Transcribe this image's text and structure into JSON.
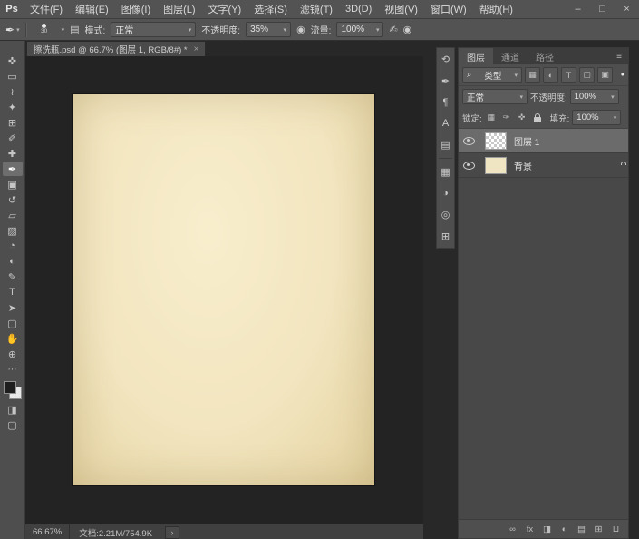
{
  "icons": {
    "caret": "▾",
    "search": "⌕",
    "dot": "●",
    "ellipsis": "⋯",
    "menu": "≡",
    "chevron": "›",
    "minimize": "–",
    "maximize": "□",
    "close": "×"
  },
  "menubar": {
    "logo": "Ps",
    "items": [
      {
        "label": "文件(F)"
      },
      {
        "label": "编辑(E)"
      },
      {
        "label": "图像(I)"
      },
      {
        "label": "图层(L)"
      },
      {
        "label": "文字(Y)"
      },
      {
        "label": "选择(S)"
      },
      {
        "label": "滤镜(T)"
      },
      {
        "label": "3D(D)"
      },
      {
        "label": "视图(V)"
      },
      {
        "label": "窗口(W)"
      },
      {
        "label": "帮助(H)"
      }
    ]
  },
  "optionsbar": {
    "tool_icon": "✒",
    "brush_size": "30",
    "brush_panel_icon": "▤",
    "mode_label": "模式:",
    "mode_value": "正常",
    "opacity_label": "不透明度:",
    "opacity_value": "35%",
    "pressure_opacity_icon": "◉",
    "flow_label": "流量:",
    "flow_value": "100%",
    "airbrush_icon": "✍",
    "pressure_size_icon": "◉"
  },
  "doc_tab": {
    "title": "擦洗瓶.psd @ 66.7% (图层 1, RGB/8#) *"
  },
  "tools": [
    {
      "name": "move-tool",
      "glyph": "✜"
    },
    {
      "name": "rectangular-marquee-tool",
      "glyph": "▭"
    },
    {
      "name": "lasso-tool",
      "glyph": "≀"
    },
    {
      "name": "quick-selection-tool",
      "glyph": "✦"
    },
    {
      "name": "crop-tool",
      "glyph": "⊞"
    },
    {
      "name": "eyedropper-tool",
      "glyph": "✐"
    },
    {
      "name": "spot-healing-brush-tool",
      "glyph": "✚"
    },
    {
      "name": "brush-tool",
      "glyph": "✒"
    },
    {
      "name": "clone-stamp-tool",
      "glyph": "▣"
    },
    {
      "name": "history-brush-tool",
      "glyph": "↺"
    },
    {
      "name": "eraser-tool",
      "glyph": "▱"
    },
    {
      "name": "gradient-tool",
      "glyph": "▨"
    },
    {
      "name": "blur-tool",
      "glyph": "◔"
    },
    {
      "name": "dodge-tool",
      "glyph": "◐"
    },
    {
      "name": "pen-tool",
      "glyph": "✎"
    },
    {
      "name": "type-tool",
      "glyph": "T"
    },
    {
      "name": "path-selection-tool",
      "glyph": "➤"
    },
    {
      "name": "rectangle-tool",
      "glyph": "▢"
    },
    {
      "name": "hand-tool",
      "glyph": "✋"
    },
    {
      "name": "zoom-tool",
      "glyph": "⊕"
    }
  ],
  "toolbar_extra": {
    "quick_mask_icon": "◨",
    "screen_mode_icon": "▢"
  },
  "panel_strip": [
    {
      "name": "history-panel",
      "glyph": "⟲"
    },
    {
      "name": "brush-presets-panel",
      "glyph": "✒"
    },
    {
      "name": "paragraph-panel",
      "glyph": "¶"
    },
    {
      "name": "character-panel",
      "glyph": "A"
    },
    {
      "name": "styles-panel",
      "glyph": "▤"
    },
    {
      "name": "swatches-panel",
      "glyph": "▦"
    },
    {
      "name": "adjustments-panel",
      "glyph": "◑"
    },
    {
      "name": "info-panel",
      "glyph": "◎"
    },
    {
      "name": "navigator-panel",
      "glyph": "⊞"
    }
  ],
  "layers_panel": {
    "tabs": [
      {
        "label": "图层"
      },
      {
        "label": "通道"
      },
      {
        "label": "路径"
      }
    ],
    "filter": {
      "kind": "类型",
      "icons": [
        {
          "name": "filter-pixel-layers",
          "glyph": "▦"
        },
        {
          "name": "filter-adjustment-layers",
          "glyph": "◐"
        },
        {
          "name": "filter-type-layers",
          "glyph": "T"
        },
        {
          "name": "filter-shape-layers",
          "glyph": "▢"
        },
        {
          "name": "filter-smart-objects",
          "glyph": "▣"
        }
      ]
    },
    "blend_mode": "正常",
    "opacity_label": "不透明度:",
    "opacity_value": "100%",
    "lock_label": "锁定:",
    "lock_icons": [
      {
        "name": "lock-transparency",
        "glyph": "▦"
      },
      {
        "name": "lock-pixels",
        "glyph": "✑"
      },
      {
        "name": "lock-position",
        "glyph": "✜"
      }
    ],
    "fill_label": "填充:",
    "fill_value": "100%",
    "layers": [
      {
        "name": "图层 1"
      },
      {
        "name": "背景"
      }
    ],
    "bottom_icons": [
      {
        "name": "link-layers",
        "glyph": "∞"
      },
      {
        "name": "layer-style",
        "glyph": "fx"
      },
      {
        "name": "add-layer-mask",
        "glyph": "◨"
      },
      {
        "name": "new-adjustment-layer",
        "glyph": "◐"
      },
      {
        "name": "new-group",
        "glyph": "▤"
      },
      {
        "name": "new-layer",
        "glyph": "⊞"
      },
      {
        "name": "delete-layer",
        "glyph": "⊔"
      }
    ]
  },
  "statusbar": {
    "zoom": "66.67%",
    "doc_label": "文档:2.21M/754.9K"
  }
}
